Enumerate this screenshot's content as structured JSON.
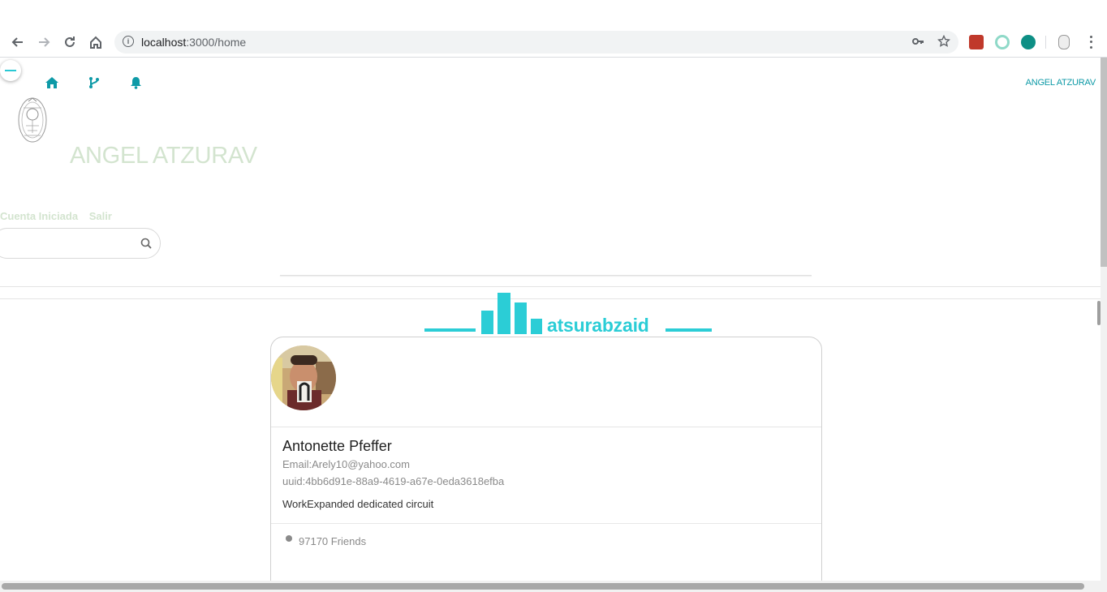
{
  "browser": {
    "url_host": "localhost",
    "url_path": ":3000/home"
  },
  "header": {
    "user_link": "ANGEL ATZURAV",
    "big_name": "ANGEL ATZURAV",
    "session_label": "Cuenta Iniciada",
    "logout_label": "Salir",
    "search_placeholder": ""
  },
  "brand": {
    "name": "atsurabzaid",
    "color": "#2bcdd6"
  },
  "profile_card": {
    "name": "Antonette Pfeffer",
    "email": "Email:Arely10@yahoo.com",
    "uuid": "uuid:4bb6d91e-88a9-4619-a67e-0eda3618efba",
    "work": "WorkExpanded dedicated circuit",
    "friends": "97170 Friends"
  },
  "icons": [
    "home-icon",
    "branch-icon",
    "bell-icon",
    "search-icon",
    "info-icon",
    "key-icon",
    "star-icon"
  ],
  "colors": {
    "accent": "#0e9aa7",
    "faded_text": "#d3e4cf"
  }
}
